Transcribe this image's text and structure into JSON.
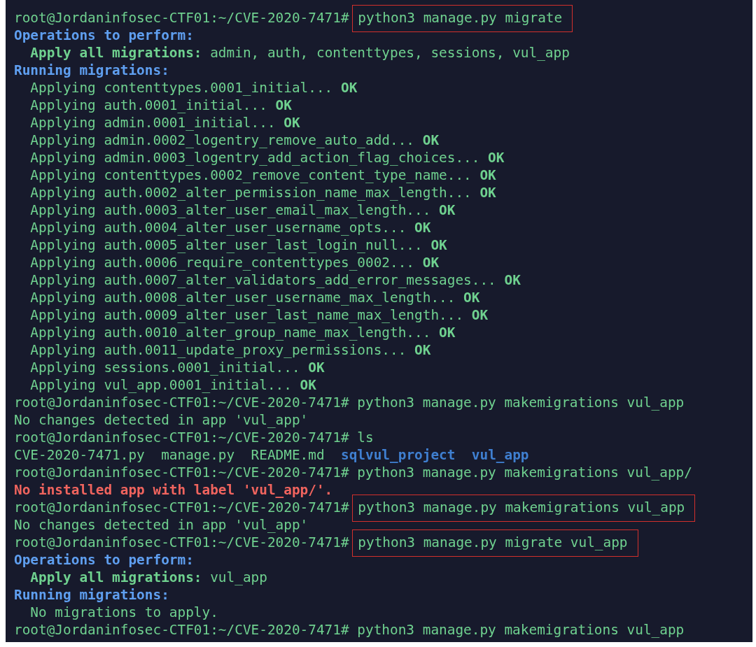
{
  "terminal": {
    "lines": [
      {
        "kind": "prompt",
        "prompt": "root@Jordaninfosec-CTF01:~/CVE-2020-7471#",
        "command": "python3 manage.py migrate",
        "highlighted": true
      },
      {
        "kind": "heading",
        "text": "Operations to perform:"
      },
      {
        "kind": "detail",
        "text": "**Apply all migrations:** admin, auth, contenttypes, sessions, vul_app"
      },
      {
        "kind": "heading",
        "text": "Running migrations:"
      },
      {
        "kind": "detail",
        "text": "Applying contenttypes.0001_initial... **OK**"
      },
      {
        "kind": "detail",
        "text": "Applying auth.0001_initial... **OK**"
      },
      {
        "kind": "detail",
        "text": "Applying admin.0001_initial... **OK**"
      },
      {
        "kind": "detail",
        "text": "Applying admin.0002_logentry_remove_auto_add... **OK**"
      },
      {
        "kind": "detail",
        "text": "Applying admin.0003_logentry_add_action_flag_choices... **OK**"
      },
      {
        "kind": "detail",
        "text": "Applying contenttypes.0002_remove_content_type_name... **OK**"
      },
      {
        "kind": "detail",
        "text": "Applying auth.0002_alter_permission_name_max_length... **OK**"
      },
      {
        "kind": "detail",
        "text": "Applying auth.0003_alter_user_email_max_length... **OK**"
      },
      {
        "kind": "detail",
        "text": "Applying auth.0004_alter_user_username_opts... **OK**"
      },
      {
        "kind": "detail",
        "text": "Applying auth.0005_alter_user_last_login_null... **OK**"
      },
      {
        "kind": "detail",
        "text": "Applying auth.0006_require_contenttypes_0002... **OK**"
      },
      {
        "kind": "detail",
        "text": "Applying auth.0007_alter_validators_add_error_messages... **OK**"
      },
      {
        "kind": "detail",
        "text": "Applying auth.0008_alter_user_username_max_length... **OK**"
      },
      {
        "kind": "detail",
        "text": "Applying auth.0009_alter_user_last_name_max_length... **OK**"
      },
      {
        "kind": "detail",
        "text": "Applying auth.0010_alter_group_name_max_length... **OK**"
      },
      {
        "kind": "detail",
        "text": "Applying auth.0011_update_proxy_permissions... **OK**"
      },
      {
        "kind": "detail",
        "text": "Applying sessions.0001_initial... **OK**"
      },
      {
        "kind": "detail",
        "text": "Applying vul_app.0001_initial... **OK**"
      },
      {
        "kind": "prompt",
        "prompt": "root@Jordaninfosec-CTF01:~/CVE-2020-7471#",
        "command": "python3 manage.py makemigrations vul_app",
        "highlighted": false
      },
      {
        "kind": "output",
        "text": "No changes detected in app 'vul_app'"
      },
      {
        "kind": "prompt",
        "prompt": "root@Jordaninfosec-CTF01:~/CVE-2020-7471#",
        "command": "ls",
        "highlighted": false
      },
      {
        "kind": "listing",
        "entries": [
          {
            "name": "CVE-2020-7471.py",
            "kind": "file"
          },
          {
            "name": "manage.py",
            "kind": "file"
          },
          {
            "name": "README.md",
            "kind": "file"
          },
          {
            "name": "sqlvul_project",
            "kind": "dir"
          },
          {
            "name": "vul_app",
            "kind": "dir"
          }
        ]
      },
      {
        "kind": "prompt",
        "prompt": "root@Jordaninfosec-CTF01:~/CVE-2020-7471#",
        "command": "python3 manage.py makemigrations vul_app/",
        "highlighted": false
      },
      {
        "kind": "error",
        "text": "No installed app with label 'vul_app/'."
      },
      {
        "kind": "prompt",
        "prompt": "root@Jordaninfosec-CTF01:~/CVE-2020-7471#",
        "command": "python3 manage.py makemigrations vul_app",
        "highlighted": true
      },
      {
        "kind": "output",
        "text": "No changes detected in app 'vul_app'"
      },
      {
        "kind": "prompt",
        "prompt": "root@Jordaninfosec-CTF01:~/CVE-2020-7471#",
        "command": "python3 manage.py migrate vul_app",
        "highlighted": true
      },
      {
        "kind": "heading",
        "text": "Operations to perform:"
      },
      {
        "kind": "detail",
        "text": "**Apply all migrations:** vul_app"
      },
      {
        "kind": "heading",
        "text": "Running migrations:"
      },
      {
        "kind": "detail",
        "text": "No migrations to apply."
      },
      {
        "kind": "prompt",
        "prompt": "root@Jordaninfosec-CTF01:~/CVE-2020-7471#",
        "command": "python3 manage.py makemigrations vul_app",
        "highlighted": false
      }
    ]
  }
}
